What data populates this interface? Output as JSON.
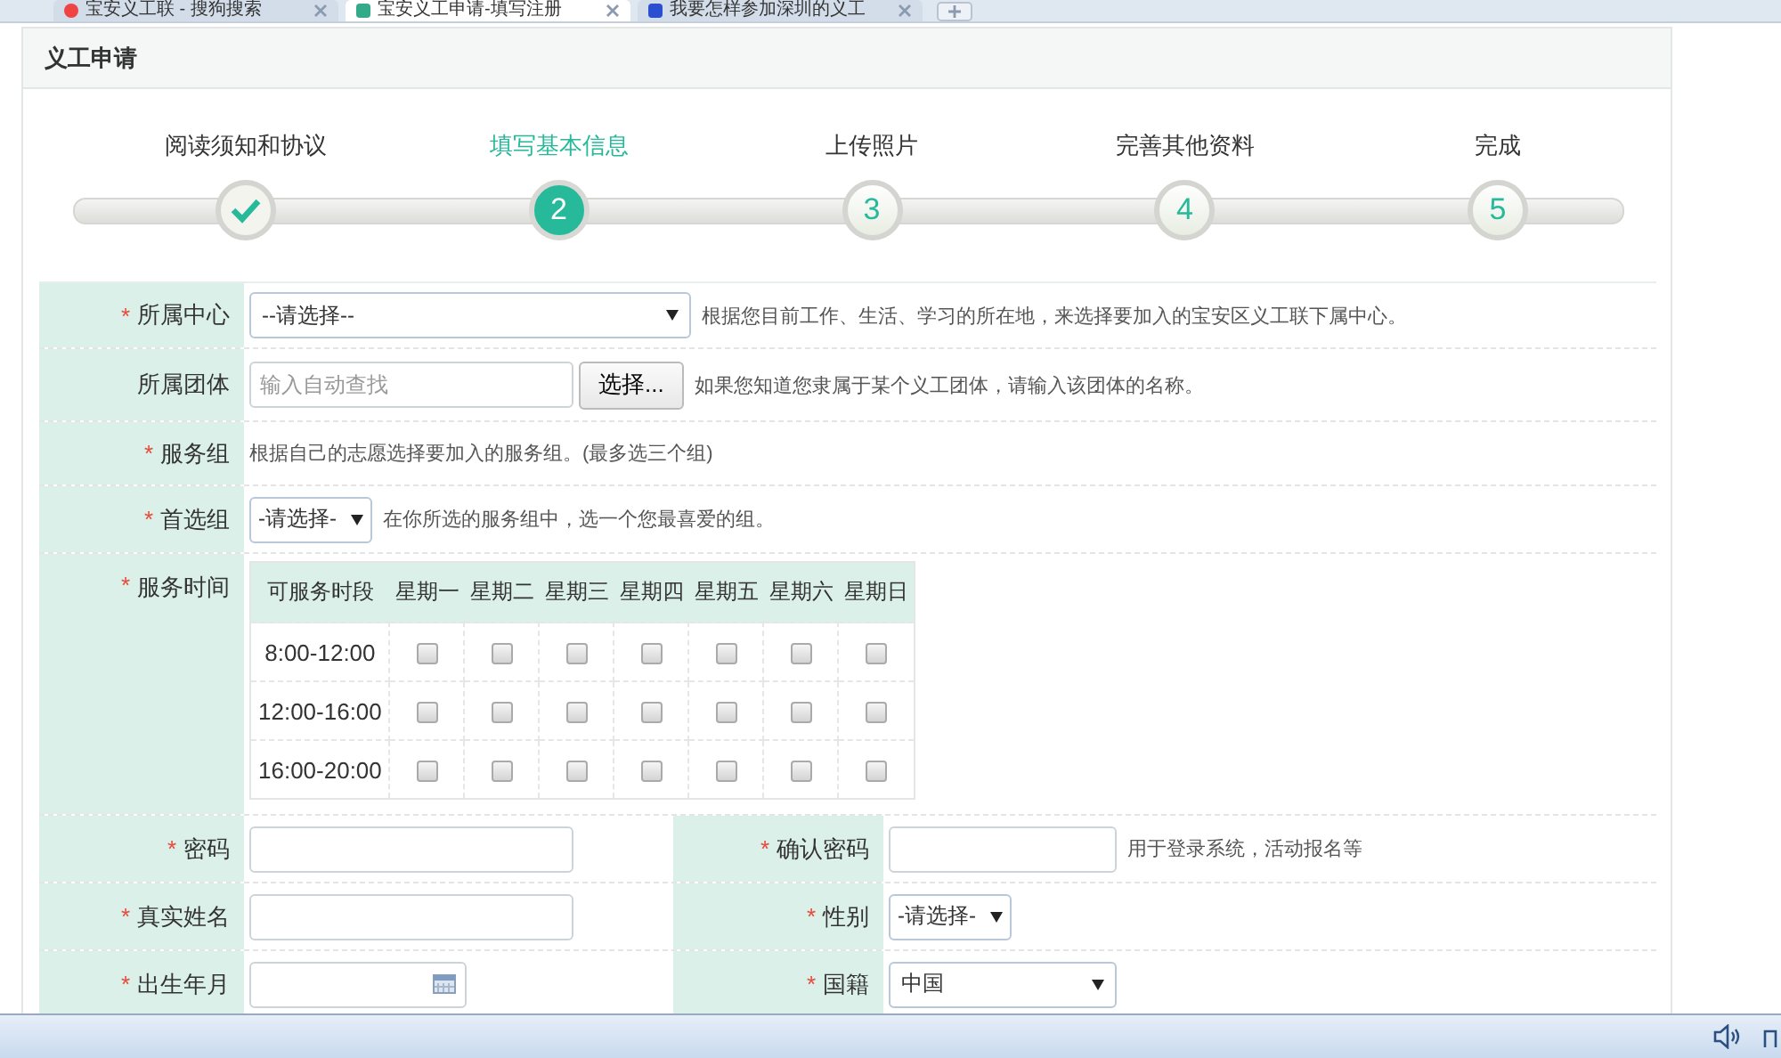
{
  "browser_tabs": [
    {
      "title": "宝安义工联 - 搜狗搜索",
      "selected": false
    },
    {
      "title": "宝安义工申请-填写注册",
      "selected": true
    },
    {
      "title": "我要怎样参加深圳的义工",
      "selected": false
    }
  ],
  "panel_title": "义工申请",
  "steps": [
    {
      "label": "阅读须知和协议",
      "completed": true,
      "selected": false
    },
    {
      "label": "填写基本信息",
      "completed": false,
      "selected": true,
      "number": "2"
    },
    {
      "label": "上传照片",
      "completed": false,
      "selected": false,
      "number": "3"
    },
    {
      "label": "完善其他资料",
      "completed": false,
      "selected": false,
      "number": "4"
    },
    {
      "label": "完成",
      "completed": false,
      "selected": false,
      "number": "5"
    }
  ],
  "form_rows": [
    {
      "kind": "select",
      "mark": "*",
      "label": "所属中心",
      "value": "--请选择--",
      "hint": "根据您目前工作、生活、学习的所在地，来选择要加入的宝安区义工联下属中心。"
    },
    {
      "kind": "search",
      "label": "所属团体",
      "placeholder": "输入自动查找",
      "button": "选择...",
      "hint": "如果您知道您隶属于某个义工团体，请输入该团体的名称。"
    },
    {
      "kind": "note",
      "mark": "*",
      "label": "服务组",
      "hint": "根据自己的志愿选择要加入的服务组。(最多选三个组)"
    },
    {
      "kind": "small_select",
      "mark": "*",
      "label": "首选组",
      "value": "-请选择-",
      "hint": "在你所选的服务组中，选一个您最喜爱的组。"
    },
    {
      "kind": "schedule",
      "mark": "*",
      "label": "服务时间",
      "columns": [
        "可服务时段",
        "星期一",
        "星期二",
        "星期三",
        "星期四",
        "星期五",
        "星期六",
        "星期日"
      ],
      "rows": [
        {
          "slot": "8:00-12:00",
          "checked": [
            false,
            false,
            false,
            false,
            false,
            false,
            false
          ]
        },
        {
          "slot": "12:00-16:00",
          "checked": [
            false,
            false,
            false,
            false,
            false,
            false,
            false
          ]
        },
        {
          "slot": "16:00-20:00",
          "checked": [
            false,
            false,
            false,
            false,
            false,
            false,
            false
          ]
        }
      ]
    },
    {
      "kind": "pair",
      "left": {
        "mark": "*",
        "label": "密码",
        "kind": "text"
      },
      "right": {
        "mark": "*",
        "label": "确认密码",
        "kind": "text",
        "hint": "用于登录系统，活动报名等"
      }
    },
    {
      "kind": "pair",
      "left": {
        "mark": "*",
        "label": "真实姓名",
        "kind": "text"
      },
      "right": {
        "mark": "*",
        "label": "性别",
        "kind": "small_select",
        "value": "-请选择-"
      }
    },
    {
      "kind": "pair",
      "left": {
        "mark": "*",
        "label": "出生年月",
        "kind": "date"
      },
      "right": {
        "mark": "*",
        "label": "国籍",
        "kind": "select",
        "value": "中国"
      }
    }
  ]
}
